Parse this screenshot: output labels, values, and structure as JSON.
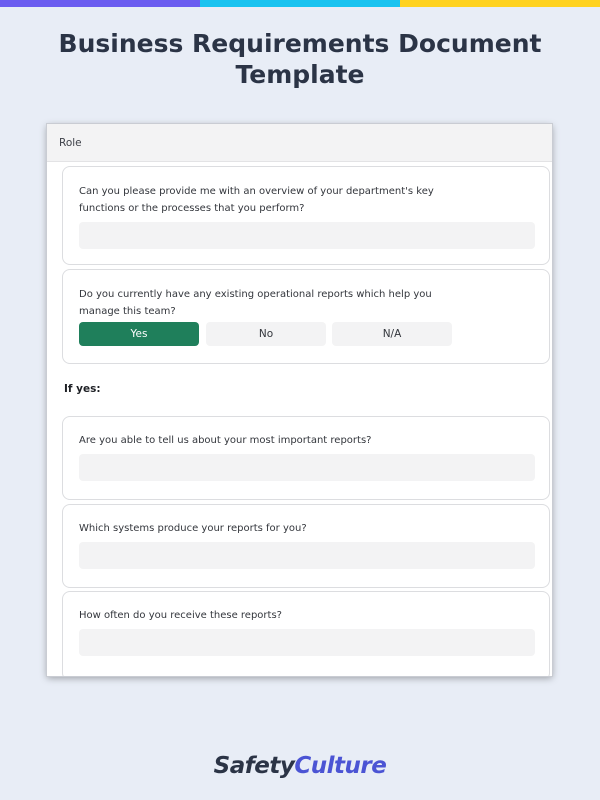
{
  "colors": {
    "background": "#e8edf6",
    "stripe": [
      "#6b5cf0",
      "#19c3f0",
      "#ffd21f"
    ],
    "selected_option": "#1f7f5b",
    "title": "#2b3446",
    "logo_accent": "#4b54d4"
  },
  "page": {
    "title": "Business Requirements Document Template"
  },
  "form": {
    "section_label": "Role",
    "if_yes_label": "If yes:",
    "questions": [
      {
        "text": "Can you please provide me with an overview of your department's key functions or the processes that you perform?",
        "answer": ""
      },
      {
        "text": "Do you currently have any existing operational reports which help you manage this team?",
        "options": [
          "Yes",
          "No",
          "N/A"
        ],
        "selected": "Yes"
      },
      {
        "text": "Are you able to tell us about your most important reports?",
        "answer": ""
      },
      {
        "text": "Which systems produce your reports for you?",
        "answer": ""
      },
      {
        "text": "How often do you receive these reports?",
        "answer": ""
      }
    ]
  },
  "footer": {
    "logo_part1": "Safety",
    "logo_part2": "Culture"
  }
}
